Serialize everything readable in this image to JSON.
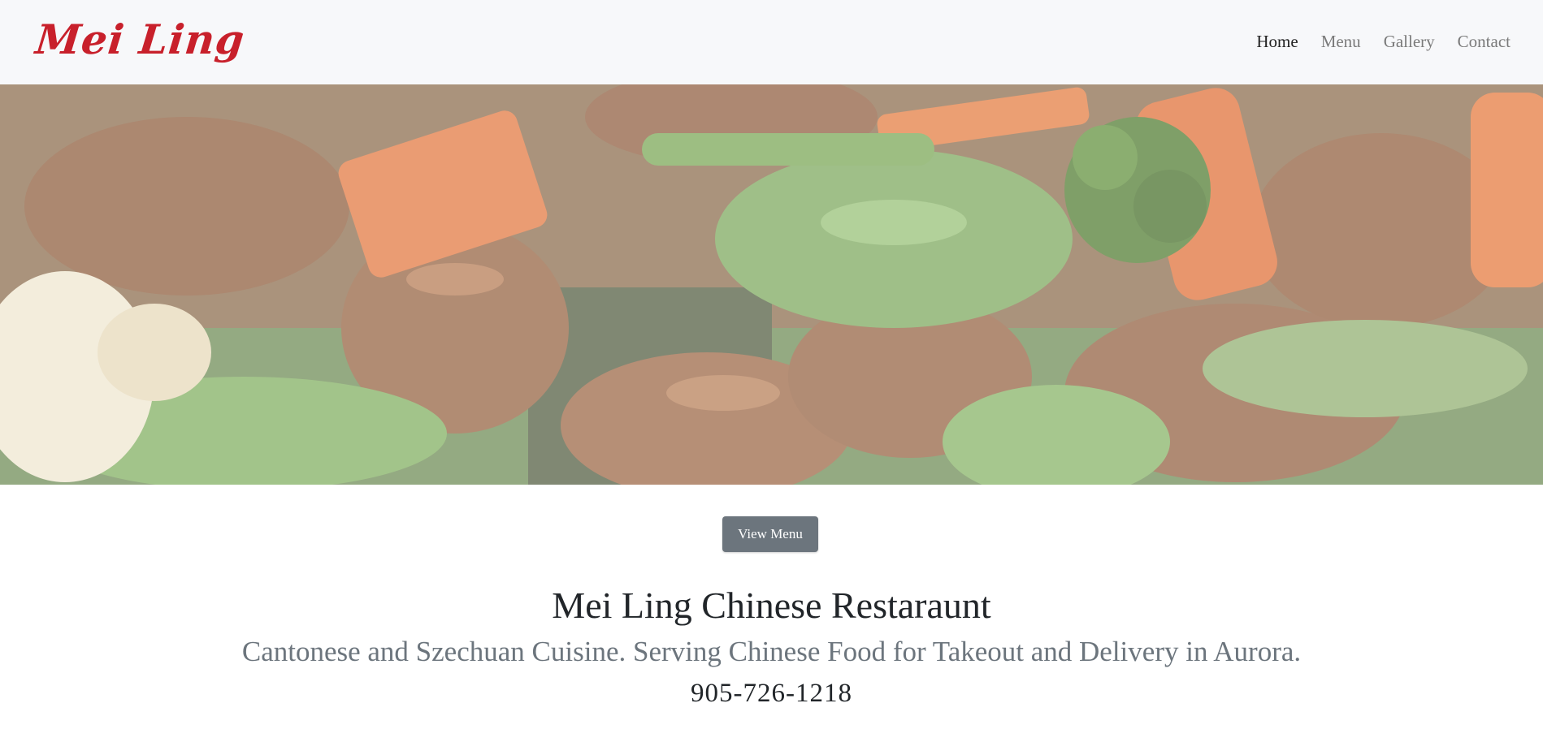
{
  "brand": {
    "name": "Mei Ling"
  },
  "nav": {
    "items": [
      {
        "label": "Home",
        "active": true
      },
      {
        "label": "Menu",
        "active": false
      },
      {
        "label": "Gallery",
        "active": false
      },
      {
        "label": "Contact",
        "active": false
      }
    ]
  },
  "hero": {
    "image_icon": "food-photo-beef-broccoli"
  },
  "cta": {
    "label": "View Menu"
  },
  "content": {
    "title": "Mei Ling Chinese Restaraunt",
    "subtitle": "Cantonese and Szechuan Cuisine. Serving Chinese Food for Takeout and Delivery in Aurora.",
    "phone": "905-726-1218"
  },
  "colors": {
    "brand": "#c8202b",
    "navbar_bg": "#f7f8fa",
    "button_bg": "#6c757d",
    "muted_text": "#6c757d"
  }
}
